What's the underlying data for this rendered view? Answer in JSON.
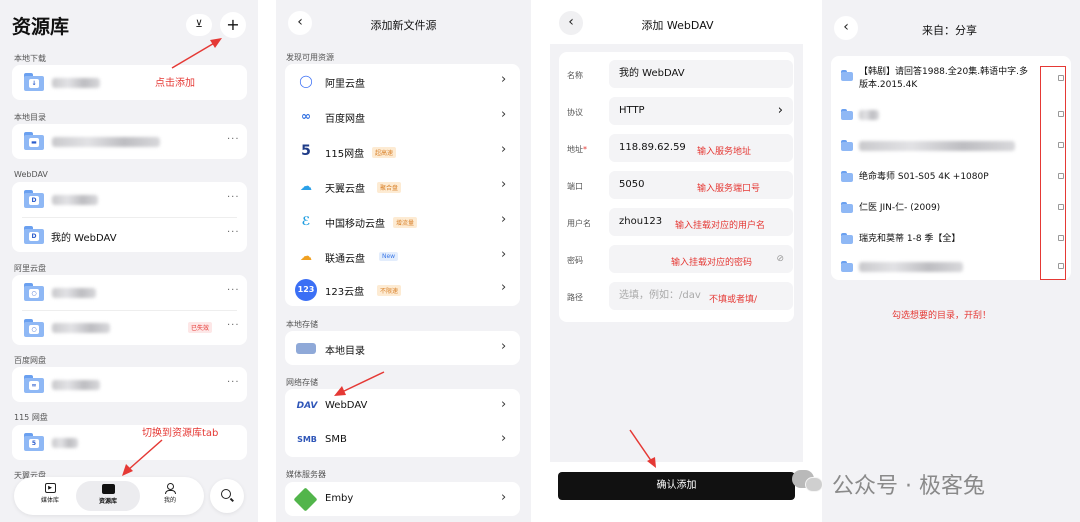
{
  "panel1": {
    "title": "资源库",
    "sections": {
      "local_downloads": "本地下载",
      "local_dirs": "本地目录",
      "webdav": "WebDAV",
      "aliyun": "阿里云盘",
      "baidu": "百度网盘",
      "p115": "115 网盘",
      "tianyi": "天翼云盘"
    },
    "webdav_item": "我的 WebDAV",
    "expired_badge": "已失效",
    "annot_add": "点击添加",
    "annot_tab": "切换到资源库tab",
    "tabs": {
      "media": "媒体库",
      "library": "资源库",
      "mine": "我的"
    },
    "more": "···"
  },
  "panel2": {
    "title": "添加新文件源",
    "sec_discover": "发现可用资源",
    "sec_local": "本地存储",
    "sec_network": "网络存储",
    "sec_media": "媒体服务器",
    "items": {
      "aliyun": "阿里云盘",
      "baidu": "百度网盘",
      "p115": "115网盘",
      "tianyi": "天翼云盘",
      "cmcc": "中国移动云盘",
      "liantong": "联通云盘",
      "p123": "123云盘",
      "local": "本地目录",
      "webdav": "WebDAV",
      "smb": "SMB",
      "emby": "Emby"
    },
    "badges": {
      "p115": "超高速",
      "tianyi": "聚合盘",
      "cmcc": "增流量",
      "liantong": "New",
      "p123": "不限速"
    },
    "icon_text": {
      "p115": "5",
      "p123": "123",
      "webdav": "DAV",
      "smb": "SMB"
    }
  },
  "panel3": {
    "title": "添加 WebDAV",
    "labels": {
      "name": "名称",
      "protocol": "协议",
      "address": "地址",
      "port": "端口",
      "username": "用户名",
      "password": "密码",
      "path": "路径"
    },
    "required_mark": "*",
    "values": {
      "name": "我的 WebDAV",
      "protocol": "HTTP",
      "address": "118.89.62.59",
      "port": "5050",
      "username": "zhou123"
    },
    "path_placeholder": "选填，例如：/dav",
    "hints": {
      "address": "输入服务地址",
      "port": "输入服务端口号",
      "username": "输入挂载对应的用户名",
      "password": "输入挂载对应的密码",
      "path": "不填或者填/"
    },
    "confirm": "确认添加"
  },
  "panel4": {
    "title": "来自：分享",
    "files": [
      "【韩剧】请回答1988.全20集.韩语中字.多版本.2015.4K",
      "",
      "",
      "绝命毒师 S01-S05 4K +1080P",
      "仁医 JIN-仁- (2009)",
      "瑞克和莫蒂 1-8 季【全】",
      ""
    ],
    "annot": "勾选想要的目录，开刮！"
  },
  "watermark": "公众号 · 极客兔"
}
